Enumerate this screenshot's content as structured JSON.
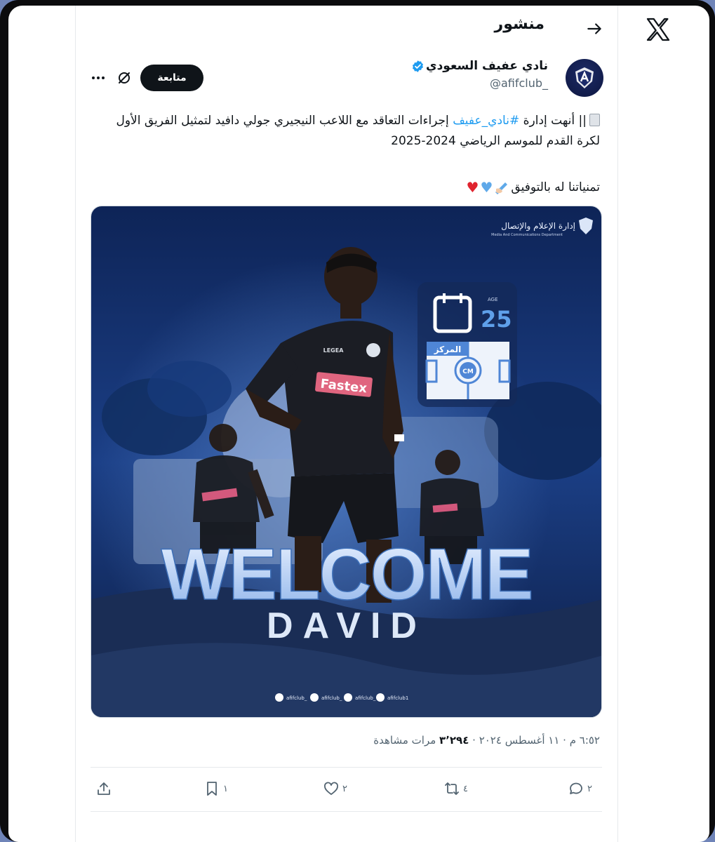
{
  "header": {
    "title": "منشور"
  },
  "author": {
    "name": "نادي عفيف السعودي",
    "handle": "@afifclub_",
    "follow_label": "متابعة"
  },
  "tweet": {
    "line1_pre": "|| أنهت إدارة ",
    "hashtag": "#نادي_عفيف",
    "line1_post": " إجراءات التعاقد مع اللاعب النيجيري جولي دافيد لتمثيل الفريق الأول لكرة القدم للموسم الرياضي 2024-2025",
    "line2": "تمنياتنا له بالتوفيق"
  },
  "media": {
    "dept_ar": "إدارة الإعلام والإتصال",
    "dept_en": "Media And Communications Department",
    "age_label": "AGE",
    "age_value": "25",
    "position_ar": "المركز",
    "position_code": "CM",
    "jersey_sponsor": "Fastex",
    "jersey_brand": "LEGEA",
    "welcome": "WELCOME",
    "player": "DAVID",
    "socials": [
      "afifclub_",
      "afifclub_",
      "afifclub_",
      "afifclub1"
    ]
  },
  "meta": {
    "time_date": "٦:٥٢ م · ١١ أغسطس ٢٠٢٤ · ",
    "views_count": "٣٬٢٩٤",
    "views_label": " مرات مشاهدة"
  },
  "actions": {
    "replies": "٢",
    "reposts": "٤",
    "likes": "٢",
    "bookmarks": "١"
  },
  "colors": {
    "accent": "#1d9bf0",
    "text": "#0f1419",
    "muted": "#536471",
    "frame": "#6f84b8"
  }
}
